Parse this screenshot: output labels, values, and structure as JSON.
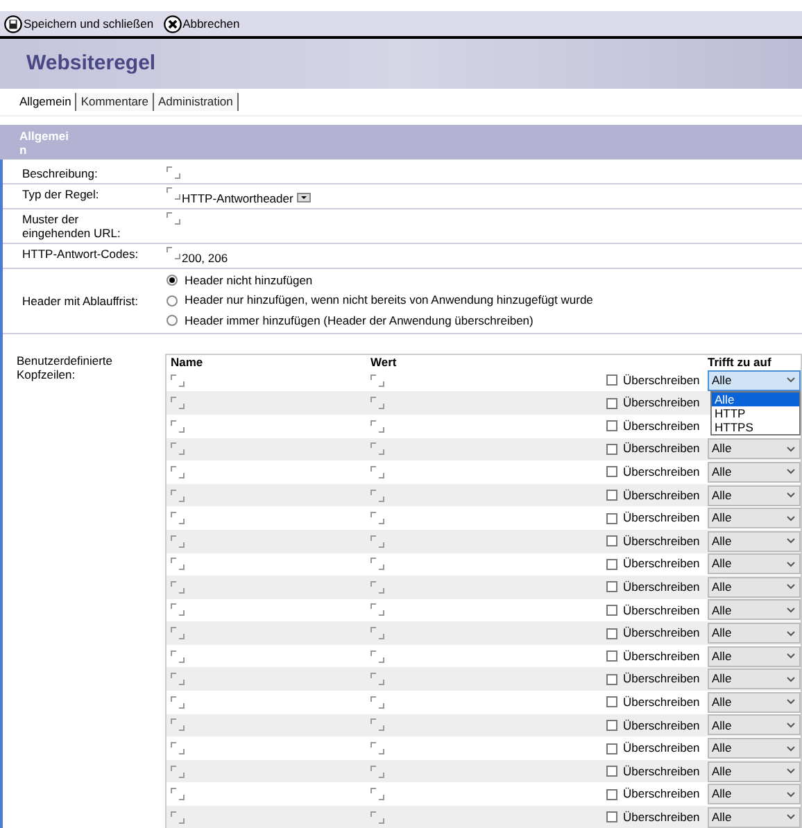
{
  "toolbar": [
    {
      "kind": "save",
      "label": "Speichern und schließen"
    },
    {
      "kind": "cancel",
      "label": "Abbrechen"
    }
  ],
  "title": "Websiteregel",
  "tabs": [
    {
      "label": "Allgemein",
      "selected": true
    },
    {
      "label": "Kommentare",
      "selected": false
    },
    {
      "label": "Administration",
      "selected": false
    }
  ],
  "section_title": "Allgemein",
  "fields": [
    {
      "kind": "text",
      "label": "Beschreibung:"
    },
    {
      "kind": "select",
      "label": "Typ der Regel:",
      "value": "HTTP-Antwortheader"
    },
    {
      "kind": "text",
      "label": "Muster der eingehenden URL:"
    },
    {
      "kind": "text",
      "label": "HTTP-Antwort-Codes:",
      "value": "200, 206"
    },
    {
      "kind": "radio",
      "label": "Header mit Ablauffrist:",
      "options": [
        {
          "label": "Header nicht hinzufügen",
          "selected": true
        },
        {
          "label": "Header nur hinzufügen, wenn nicht bereits von Anwendung hinzugefügt wurde",
          "selected": false
        },
        {
          "label": "Header immer hinzufügen (Header der Anwendung überschreiben)",
          "selected": false
        }
      ]
    }
  ],
  "headers_label": "Benutzerdefinierte Kopfzeilen:",
  "table": {
    "columns": [
      "Name",
      "Wert",
      "Trifft zu auf"
    ],
    "rows": [
      {
        "overwrite_label": "Überschreiben",
        "checked": false,
        "applies_to": "Alle",
        "expanded": true,
        "options": [
          {
            "label": "Alle",
            "selected": true
          },
          {
            "label": "HTTP",
            "selected": false
          },
          {
            "label": "HTTPS",
            "selected": false
          }
        ]
      },
      {
        "overwrite_label": "Überschreiben",
        "checked": false
      },
      {
        "overwrite_label": "Überschreiben",
        "checked": false
      },
      {
        "overwrite_label": "Überschreiben",
        "checked": false,
        "applies_to": "Alle",
        "expanded": false
      },
      {
        "overwrite_label": "Überschreiben",
        "checked": false,
        "applies_to": "Alle",
        "expanded": false
      },
      {
        "overwrite_label": "Überschreiben",
        "checked": false,
        "applies_to": "Alle",
        "expanded": false
      },
      {
        "overwrite_label": "Überschreiben",
        "checked": false,
        "applies_to": "Alle",
        "expanded": false
      },
      {
        "overwrite_label": "Überschreiben",
        "checked": false,
        "applies_to": "Alle",
        "expanded": false
      },
      {
        "overwrite_label": "Überschreiben",
        "checked": false,
        "applies_to": "Alle",
        "expanded": false
      },
      {
        "overwrite_label": "Überschreiben",
        "checked": false,
        "applies_to": "Alle",
        "expanded": false
      },
      {
        "overwrite_label": "Überschreiben",
        "checked": false,
        "applies_to": "Alle",
        "expanded": false
      },
      {
        "overwrite_label": "Überschreiben",
        "checked": false,
        "applies_to": "Alle",
        "expanded": false
      },
      {
        "overwrite_label": "Überschreiben",
        "checked": false,
        "applies_to": "Alle",
        "expanded": false
      },
      {
        "overwrite_label": "Überschreiben",
        "checked": false,
        "applies_to": "Alle",
        "expanded": false
      },
      {
        "overwrite_label": "Überschreiben",
        "checked": false,
        "applies_to": "Alle",
        "expanded": false
      },
      {
        "overwrite_label": "Überschreiben",
        "checked": false,
        "applies_to": "Alle",
        "expanded": false
      },
      {
        "overwrite_label": "Überschreiben",
        "checked": false,
        "applies_to": "Alle",
        "expanded": false
      },
      {
        "overwrite_label": "Überschreiben",
        "checked": false,
        "applies_to": "Alle",
        "expanded": false
      },
      {
        "overwrite_label": "Überschreiben",
        "checked": false,
        "applies_to": "Alle",
        "expanded": false
      },
      {
        "overwrite_label": "Überschreiben",
        "checked": false,
        "applies_to": "Alle",
        "expanded": false
      }
    ]
  }
}
